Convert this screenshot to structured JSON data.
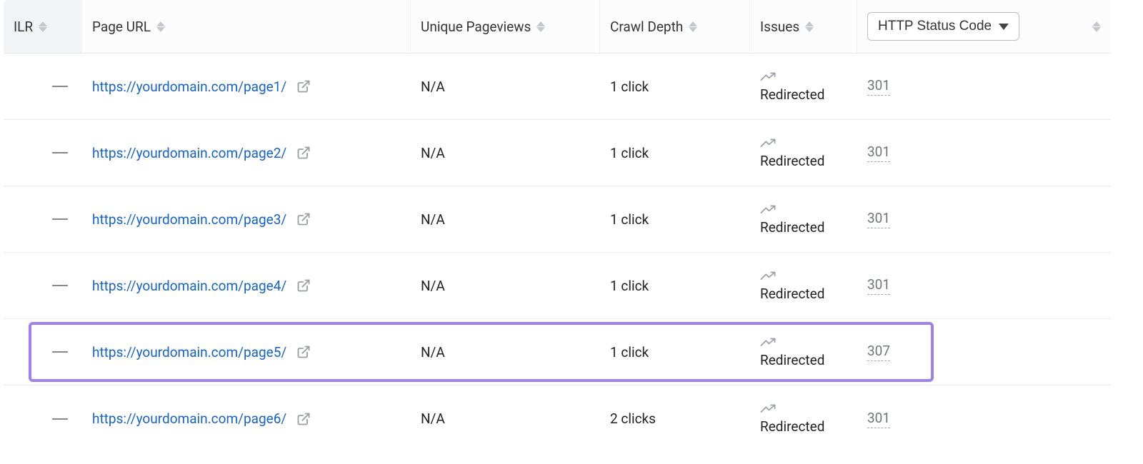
{
  "headers": {
    "ilr": "ILR",
    "url": "Page URL",
    "unique_pageviews": "Unique Pageviews",
    "crawl_depth": "Crawl Depth",
    "issues": "Issues",
    "http_status": "HTTP Status Code"
  },
  "rows": [
    {
      "ilr": "—",
      "url": "https://yourdomain.com/page1/",
      "unique_pageviews": "N/A",
      "crawl_depth": "1 click",
      "issue_label": "Redirected",
      "status_code": "301",
      "highlighted": false
    },
    {
      "ilr": "—",
      "url": "https://yourdomain.com/page2/",
      "unique_pageviews": "N/A",
      "crawl_depth": "1 click",
      "issue_label": "Redirected",
      "status_code": "301",
      "highlighted": false
    },
    {
      "ilr": "—",
      "url": "https://yourdomain.com/page3/",
      "unique_pageviews": "N/A",
      "crawl_depth": "1 click",
      "issue_label": "Redirected",
      "status_code": "301",
      "highlighted": false
    },
    {
      "ilr": "—",
      "url": "https://yourdomain.com/page4/",
      "unique_pageviews": "N/A",
      "crawl_depth": "1 click",
      "issue_label": "Redirected",
      "status_code": "301",
      "highlighted": false
    },
    {
      "ilr": "—",
      "url": "https://yourdomain.com/page5/",
      "unique_pageviews": "N/A",
      "crawl_depth": "1 click",
      "issue_label": "Redirected",
      "status_code": "307",
      "highlighted": true
    },
    {
      "ilr": "—",
      "url": "https://yourdomain.com/page6/",
      "unique_pageviews": "N/A",
      "crawl_depth": "2 clicks",
      "issue_label": "Redirected",
      "status_code": "301",
      "highlighted": false
    }
  ]
}
